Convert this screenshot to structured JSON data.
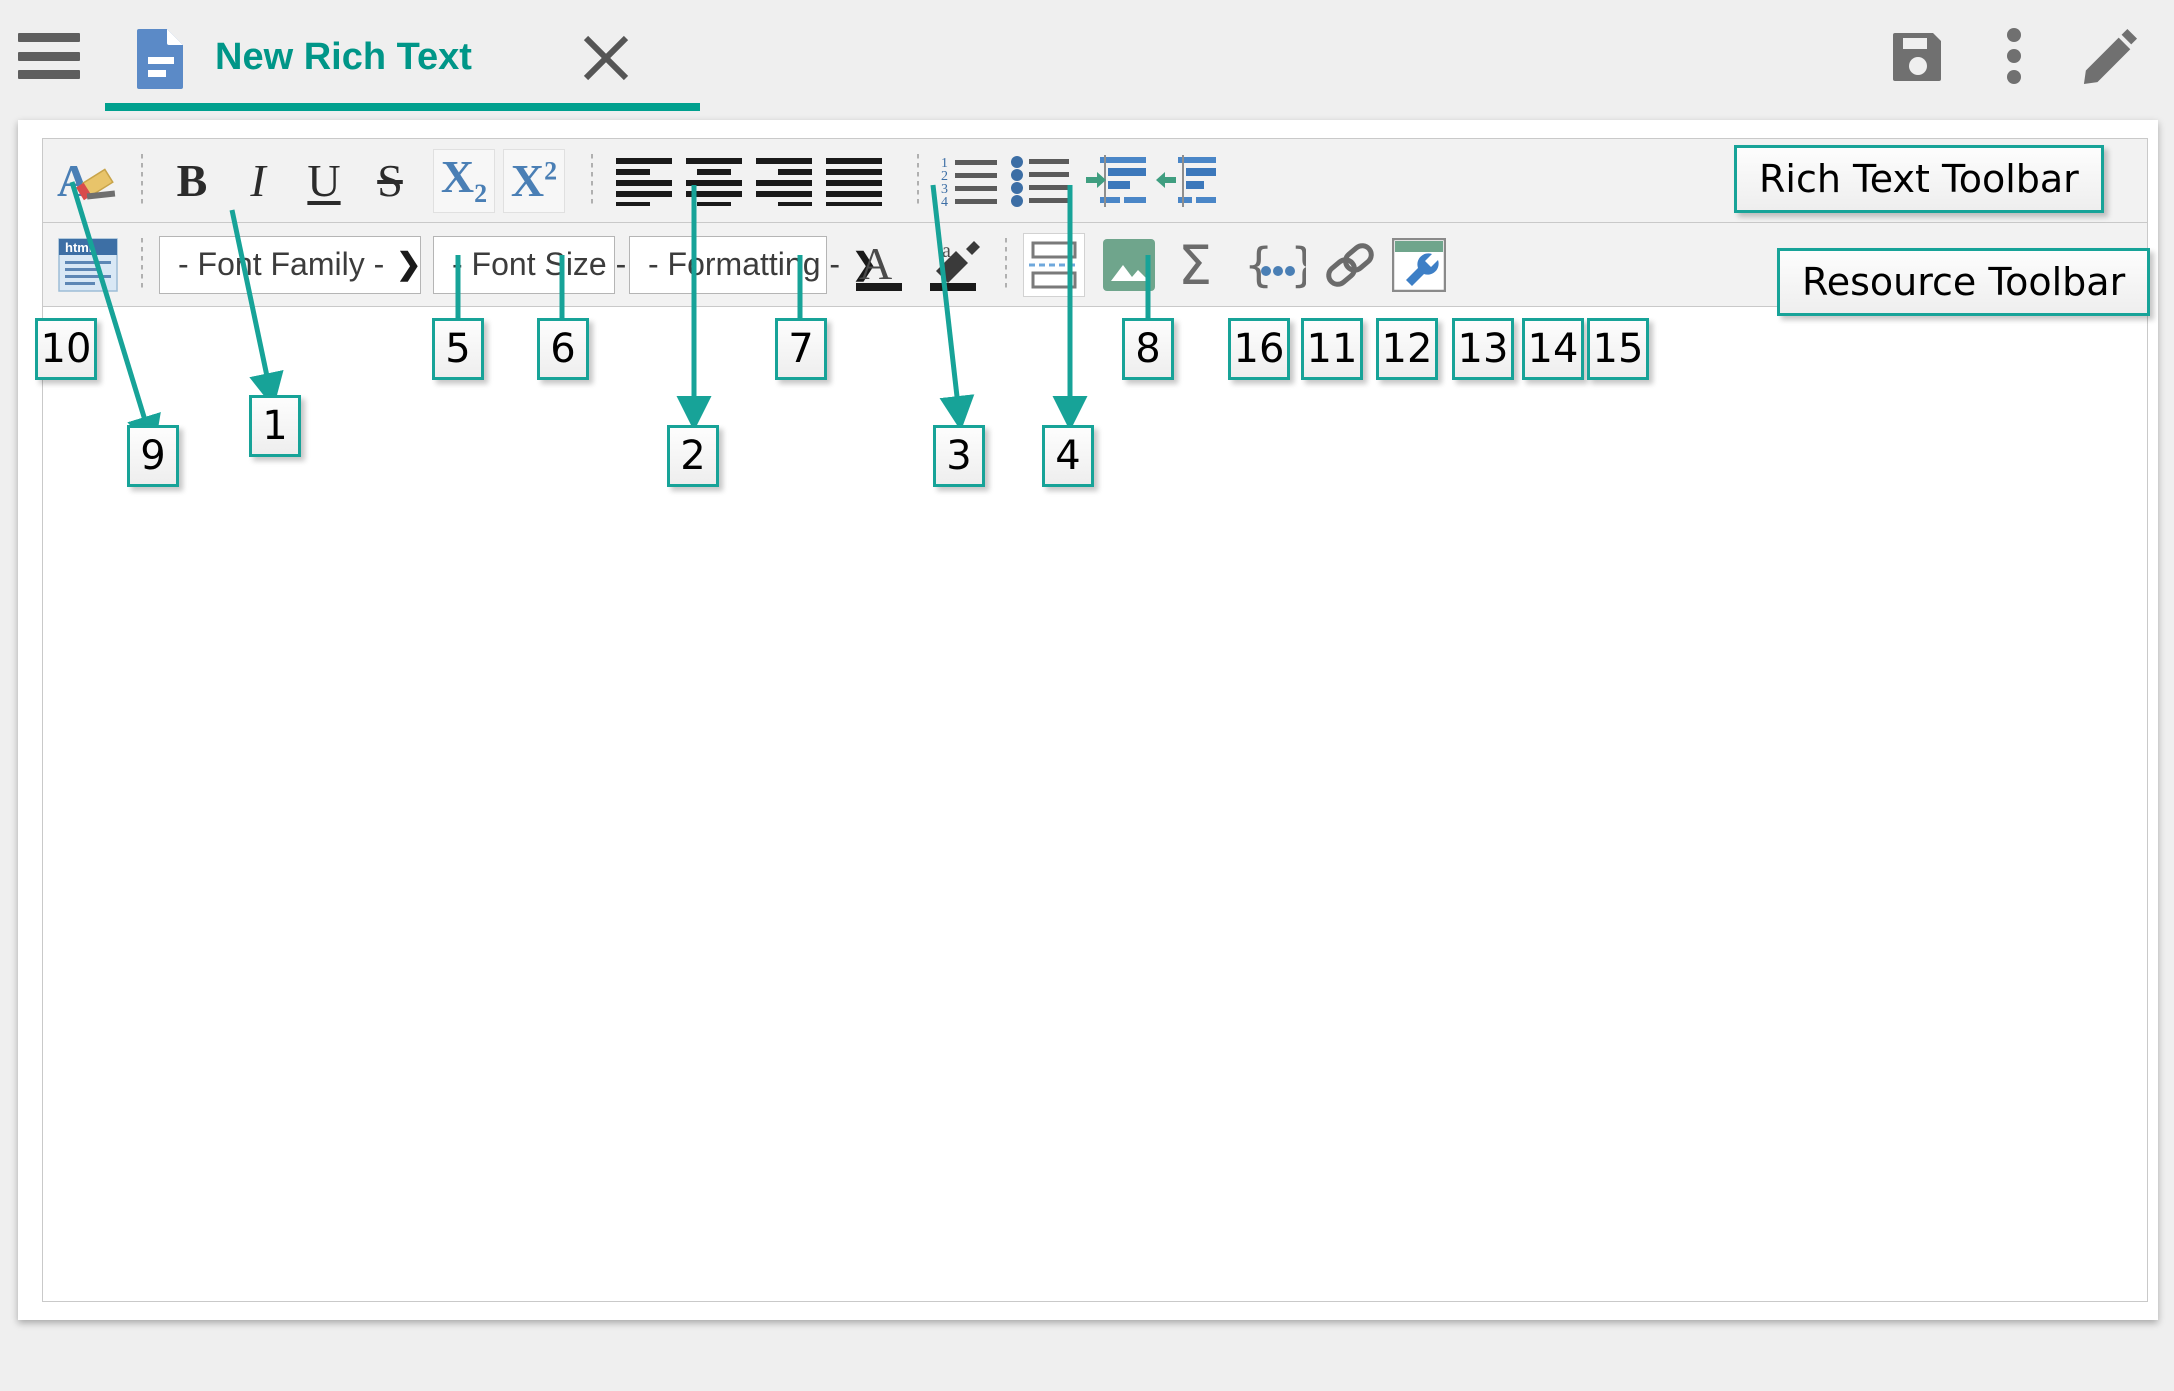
{
  "header": {
    "menu_icon": "hamburger-menu-icon",
    "tab": {
      "icon": "document-icon",
      "title": "New Rich Text",
      "close_label": "close-icon"
    },
    "actions": [
      {
        "name": "save-icon",
        "label": "Save"
      },
      {
        "name": "more-options-icon",
        "label": "More options"
      },
      {
        "name": "edit-pencil-icon",
        "label": "Edit"
      }
    ]
  },
  "rich_text_toolbar": {
    "name": "Rich Text Toolbar",
    "items": [
      {
        "name": "clear-formatting-icon",
        "label": "Clear Formatting"
      },
      {
        "name": "bold-button",
        "label": "B"
      },
      {
        "name": "italic-button",
        "label": "I"
      },
      {
        "name": "underline-button",
        "label": "U"
      },
      {
        "name": "strikethrough-button",
        "label": "S"
      },
      {
        "name": "subscript-button",
        "label": "X",
        "sub": "2"
      },
      {
        "name": "superscript-button",
        "label": "X",
        "sup": "2"
      },
      {
        "name": "align-left-button",
        "label": "Align Left"
      },
      {
        "name": "align-center-button",
        "label": "Align Center"
      },
      {
        "name": "align-right-button",
        "label": "Align Right"
      },
      {
        "name": "align-justify-button",
        "label": "Justify"
      },
      {
        "name": "numbered-list-button",
        "label": "Numbered List"
      },
      {
        "name": "bulleted-list-button",
        "label": "Bulleted List"
      },
      {
        "name": "indent-button",
        "label": "Indent"
      },
      {
        "name": "outdent-button",
        "label": "Outdent"
      }
    ]
  },
  "resource_toolbar": {
    "name": "Resource Toolbar",
    "html_source_icon": "html-source-icon",
    "html_source_label": "html",
    "selects": [
      {
        "name": "font-family-select",
        "value": "- Font Family -",
        "chevron": "❯"
      },
      {
        "name": "font-size-select",
        "value": "- Font Size -",
        "chevron": "❯"
      },
      {
        "name": "formatting-select",
        "value": "- Formatting -",
        "chevron": "❯"
      }
    ],
    "items": [
      {
        "name": "text-color-icon",
        "label": "Text Color"
      },
      {
        "name": "highlight-color-icon",
        "label": "Background Color"
      },
      {
        "name": "page-break-icon",
        "label": "Page Break"
      },
      {
        "name": "insert-image-icon",
        "label": "Insert Image"
      },
      {
        "name": "insert-equation-icon",
        "label": "Insert Equation"
      },
      {
        "name": "insert-placeholder-icon",
        "label": "Insert Placeholder"
      },
      {
        "name": "insert-link-icon",
        "label": "Insert Link"
      },
      {
        "name": "tools-wrench-icon",
        "label": "Tools"
      }
    ]
  },
  "annotations": {
    "labels": [
      {
        "id": "rich-text-toolbar-label",
        "text": "Rich Text Toolbar"
      },
      {
        "id": "resource-toolbar-label",
        "text": "Resource Toolbar"
      }
    ],
    "numbers": [
      {
        "id": "callout-10",
        "text": "10"
      },
      {
        "id": "callout-9",
        "text": "9"
      },
      {
        "id": "callout-1",
        "text": "1"
      },
      {
        "id": "callout-5",
        "text": "5"
      },
      {
        "id": "callout-6",
        "text": "6"
      },
      {
        "id": "callout-2",
        "text": "2"
      },
      {
        "id": "callout-7",
        "text": "7"
      },
      {
        "id": "callout-3",
        "text": "3"
      },
      {
        "id": "callout-4",
        "text": "4"
      },
      {
        "id": "callout-8",
        "text": "8"
      },
      {
        "id": "callout-16",
        "text": "16"
      },
      {
        "id": "callout-11",
        "text": "11"
      },
      {
        "id": "callout-12",
        "text": "12"
      },
      {
        "id": "callout-13",
        "text": "13"
      },
      {
        "id": "callout-14",
        "text": "14"
      },
      {
        "id": "callout-15",
        "text": "15"
      }
    ]
  },
  "colors": {
    "accent_teal": "#009688",
    "annotation_teal": "#17a398",
    "icon_gray": "#6b6b6b",
    "blue": "#4a7fb5",
    "page_bg": "#efefef"
  }
}
